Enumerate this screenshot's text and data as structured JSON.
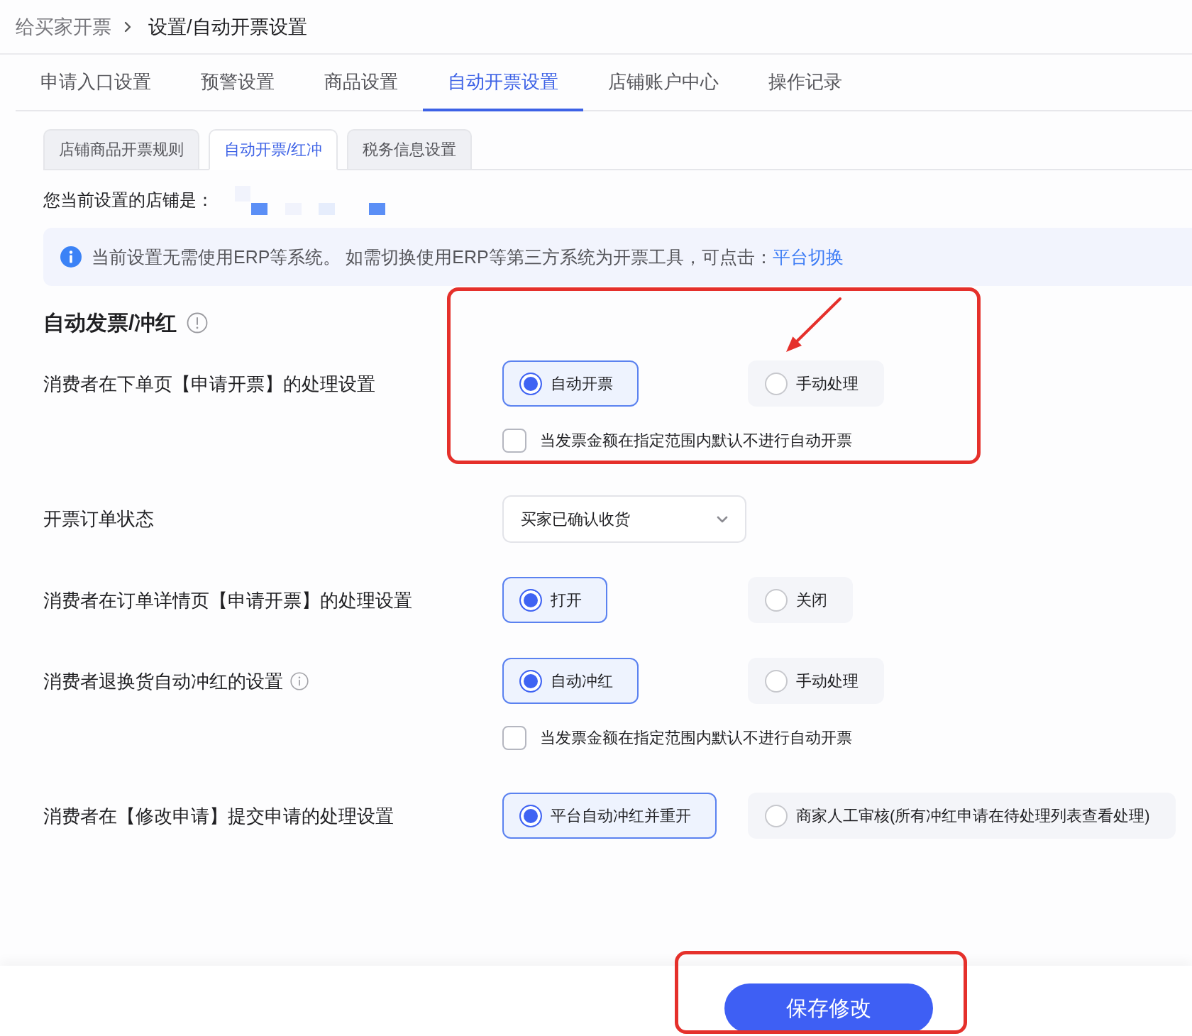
{
  "breadcrumb": [
    {
      "label": "给买家开票",
      "current": false
    },
    {
      "label": "设置/自动开票设置",
      "current": true
    }
  ],
  "tabs": [
    {
      "label": "申请入口设置",
      "selected": false
    },
    {
      "label": "预警设置",
      "selected": false
    },
    {
      "label": "商品设置",
      "selected": false
    },
    {
      "label": "自动开票设置",
      "selected": true
    },
    {
      "label": "店铺账户中心",
      "selected": false
    },
    {
      "label": "操作记录",
      "selected": false
    }
  ],
  "sub_tabs": [
    {
      "label": "店铺商品开票规则",
      "selected": false
    },
    {
      "label": "自动开票/红冲",
      "selected": true
    },
    {
      "label": "税务信息设置",
      "selected": false
    }
  ],
  "store": {
    "label": "您当前设置的店铺是："
  },
  "notice": {
    "text": "当前设置无需使用ERP等系统。 如需切换使用ERP等第三方系统为开票工具，可点击：",
    "link": "平台切换"
  },
  "section": {
    "title": "自动发票/冲红"
  },
  "settings": [
    {
      "kind": "radio",
      "label": "消费者在下单页【申请开票】的处理设置",
      "info": false,
      "options": [
        {
          "label": "自动开票",
          "selected": true
        },
        {
          "label": "手动处理",
          "selected": false
        }
      ],
      "checkbox": {
        "label": "当发票金额在指定范围内默认不进行自动开票",
        "checked": false
      }
    },
    {
      "kind": "select",
      "label": "开票订单状态",
      "info": false,
      "value": "买家已确认收货"
    },
    {
      "kind": "radio",
      "label": "消费者在订单详情页【申请开票】的处理设置",
      "info": false,
      "options": [
        {
          "label": "打开",
          "selected": true
        },
        {
          "label": "关闭",
          "selected": false
        }
      ]
    },
    {
      "kind": "radio",
      "label": "消费者退换货自动冲红的设置",
      "info": true,
      "options": [
        {
          "label": "自动冲红",
          "selected": true
        },
        {
          "label": "手动处理",
          "selected": false
        }
      ],
      "checkbox": {
        "label": "当发票金额在指定范围内默认不进行自动开票",
        "checked": false
      }
    },
    {
      "kind": "radio",
      "label": "消费者在【修改申请】提交申请的处理设置",
      "info": false,
      "options": [
        {
          "label": "平台自动冲红并重开",
          "selected": true
        },
        {
          "label": "商家人工审核(所有冲红申请在待处理列表查看处理)",
          "selected": false
        }
      ]
    }
  ],
  "save_button": {
    "label": "保存修改"
  }
}
